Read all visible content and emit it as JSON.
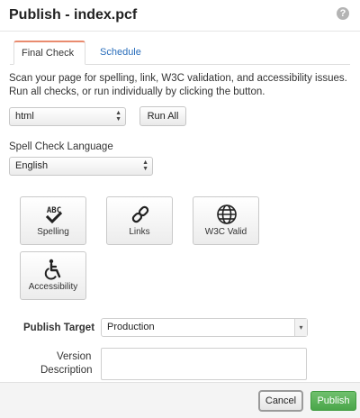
{
  "dialog": {
    "title": "Publish - index.pcf",
    "help_icon": "question-icon"
  },
  "tabs": [
    {
      "label": "Final Check",
      "active": true
    },
    {
      "label": "Schedule",
      "active": false
    }
  ],
  "final_check": {
    "intro": "Scan your page for spelling, link, W3C validation, and accessibility issues. Run all checks, or run individually by clicking the button.",
    "scope_select": {
      "value": "html"
    },
    "run_all_label": "Run All",
    "spell_language_label": "Spell Check Language",
    "spell_language_select": {
      "value": "English"
    },
    "checks": [
      {
        "label": "Spelling",
        "icon": "spellcheck-icon"
      },
      {
        "label": "Links",
        "icon": "link-icon"
      },
      {
        "label": "W3C Valid",
        "icon": "globe-icon"
      },
      {
        "label": "Accessibility",
        "icon": "accessibility-icon"
      }
    ]
  },
  "publish": {
    "target_label": "Publish Target",
    "target_value": "Production",
    "version_label_line1": "Version",
    "version_label_line2": "Description",
    "version_value": ""
  },
  "footer": {
    "cancel_label": "Cancel",
    "publish_label": "Publish"
  },
  "colors": {
    "accent_tab": "#e98b6f",
    "link": "#2a6ebb",
    "publish_green": "#4aa64a"
  }
}
